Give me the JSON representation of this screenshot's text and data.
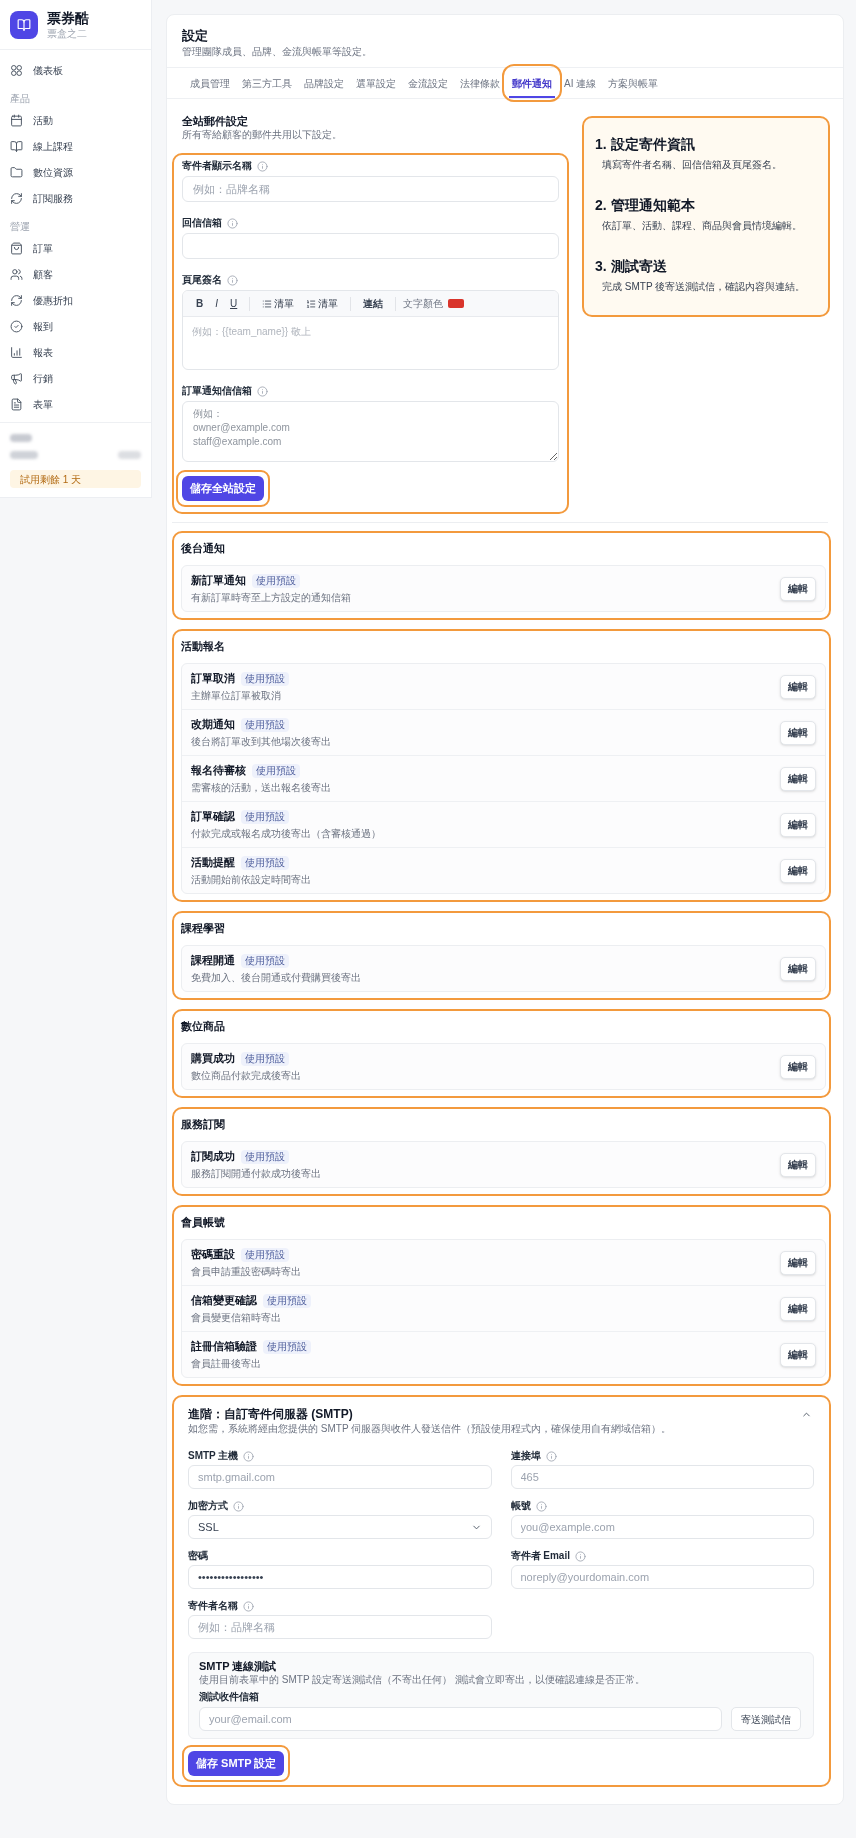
{
  "sidebar": {
    "brand": {
      "name": "票券酷",
      "subtitle": "票盒之二"
    },
    "nav": [
      {
        "items": [
          {
            "label": "儀表板"
          }
        ]
      },
      {
        "heading": "產品",
        "items": [
          {
            "label": "活動"
          },
          {
            "label": "線上課程"
          },
          {
            "label": "數位資源"
          },
          {
            "label": "訂閱服務"
          }
        ]
      },
      {
        "heading": "營運",
        "items": [
          {
            "label": "訂單"
          },
          {
            "label": "顧客"
          },
          {
            "label": "優惠折扣"
          },
          {
            "label": "報到"
          },
          {
            "label": "報表"
          },
          {
            "label": "行銷"
          },
          {
            "label": "表單"
          }
        ]
      }
    ],
    "trial_badge": "試用剩餘 1 天"
  },
  "page": {
    "title": "設定",
    "subtitle": "管理團隊成員、品牌、金流與帳單等設定。"
  },
  "tabs": [
    {
      "label": "成員管理",
      "selected": false,
      "highlighted": false
    },
    {
      "label": "第三方工具",
      "selected": false,
      "highlighted": false
    },
    {
      "label": "品牌設定",
      "selected": false,
      "highlighted": false
    },
    {
      "label": "選單設定",
      "selected": false,
      "highlighted": false
    },
    {
      "label": "金流設定",
      "selected": false,
      "highlighted": false
    },
    {
      "label": "法律條款",
      "selected": false,
      "highlighted": false
    },
    {
      "label": "郵件通知",
      "selected": true,
      "highlighted": true
    },
    {
      "label": "AI 連線",
      "selected": false,
      "highlighted": false
    },
    {
      "label": "方案與帳單",
      "selected": false,
      "highlighted": false
    }
  ],
  "global_settings": {
    "title": "全站郵件設定",
    "subtitle": "所有寄給顧客的郵件共用以下設定。",
    "highlighted": true,
    "fields": [
      {
        "kind": "input",
        "label": "寄件者顯示名稱",
        "info": true,
        "placeholder": "例如：品牌名稱"
      },
      {
        "kind": "input",
        "label": "回信信箱",
        "info": true
      },
      {
        "kind": "editor",
        "label": "頁尾簽名",
        "info": true,
        "toolbar": [
          {
            "kind": "bold",
            "label": "B"
          },
          {
            "kind": "italic",
            "label": "I"
          },
          {
            "kind": "underline",
            "label": "U"
          },
          {
            "kind": "bullet_list",
            "label": "清單"
          },
          {
            "kind": "numbered_list",
            "label": "清單"
          },
          {
            "kind": "link",
            "label": "連結"
          },
          {
            "kind": "color",
            "label": "文字顏色",
            "color": "#d9342b"
          }
        ],
        "placeholder": "例如：{{team_name}} 敬上"
      },
      {
        "kind": "textarea",
        "label": "訂單通知信信箱",
        "info": true,
        "placeholder": "例如：\nowner@example.com\nstaff@example.com"
      }
    ],
    "save_button": {
      "label": "儲存全站設定",
      "highlighted": true
    }
  },
  "guide": {
    "highlighted": true,
    "steps": [
      {
        "title": "1. 設定寄件資訊",
        "text": "填寫寄件者名稱、回信信箱及頁尾簽名。"
      },
      {
        "title": "2. 管理通知範本",
        "text": "依訂單、活動、課程、商品與會員情境編輯。"
      },
      {
        "title": "3. 測試寄送",
        "text": "完成 SMTP 後寄送測試信，確認內容與連結。"
      }
    ]
  },
  "template_sections": [
    {
      "title": "後台通知",
      "highlighted": true,
      "templates": [
        {
          "name": "新訂單通知",
          "badge": "使用預設",
          "description": "有新訂單時寄至上方設定的通知信箱",
          "action": "編輯"
        }
      ]
    },
    {
      "title": "活動報名",
      "highlighted": true,
      "templates": [
        {
          "name": "訂單取消",
          "badge": "使用預設",
          "description": "主辦單位訂單被取消",
          "action": "編輯"
        },
        {
          "name": "改期通知",
          "badge": "使用預設",
          "description": "後台將訂單改到其他場次後寄出",
          "action": "編輯"
        },
        {
          "name": "報名待審核",
          "badge": "使用預設",
          "description": "需審核的活動，送出報名後寄出",
          "action": "編輯"
        },
        {
          "name": "訂單確認",
          "badge": "使用預設",
          "description": "付款完成或報名成功後寄出（含審核通過）",
          "action": "編輯"
        },
        {
          "name": "活動提醒",
          "badge": "使用預設",
          "description": "活動開始前依設定時間寄出",
          "action": "編輯"
        }
      ]
    },
    {
      "title": "課程學習",
      "highlighted": true,
      "templates": [
        {
          "name": "課程開通",
          "badge": "使用預設",
          "description": "免費加入、後台開通或付費購買後寄出",
          "action": "編輯"
        }
      ]
    },
    {
      "title": "數位商品",
      "highlighted": true,
      "templates": [
        {
          "name": "購買成功",
          "badge": "使用預設",
          "description": "數位商品付款完成後寄出",
          "action": "編輯"
        }
      ]
    },
    {
      "title": "服務訂閱",
      "highlighted": true,
      "templates": [
        {
          "name": "訂閱成功",
          "badge": "使用預設",
          "description": "服務訂閱開通付款成功後寄出",
          "action": "編輯"
        }
      ]
    },
    {
      "title": "會員帳號",
      "highlighted": true,
      "templates": [
        {
          "name": "密碼重設",
          "badge": "使用預設",
          "description": "會員申請重設密碼時寄出",
          "action": "編輯"
        },
        {
          "name": "信箱變更確認",
          "badge": "使用預設",
          "description": "會員變更信箱時寄出",
          "action": "編輯"
        },
        {
          "name": "註冊信箱驗證",
          "badge": "使用預設",
          "description": "會員註冊後寄出",
          "action": "編輯"
        }
      ]
    }
  ],
  "smtp": {
    "title": "進階：自訂寄件伺服器 (SMTP)",
    "description": "如您需，系統將經由您提供的 SMTP 伺服器與收件人發送信件（預設使用程式內，確保使用自有網域信箱）。",
    "expanded": true,
    "highlighted": true,
    "fields": [
      {
        "kind": "input",
        "label": "SMTP 主機",
        "info": true,
        "placeholder": "smtp.gmail.com"
      },
      {
        "kind": "input",
        "label": "連接埠",
        "info": true,
        "placeholder": "465"
      },
      {
        "kind": "select",
        "label": "加密方式",
        "info": true,
        "value": "SSL"
      },
      {
        "kind": "input",
        "label": "帳號",
        "info": true,
        "placeholder": "you@example.com"
      },
      {
        "kind": "input",
        "label": "密碼",
        "info": false,
        "value": "•••••••••••••••••"
      },
      {
        "kind": "input",
        "label": "寄件者 Email",
        "info": true,
        "placeholder": "noreply@yourdomain.com"
      },
      {
        "kind": "input",
        "label": "寄件者名稱",
        "info": true,
        "placeholder": "例如：品牌名稱"
      }
    ],
    "test": {
      "title": "SMTP 連線測試",
      "description": "使用目前表單中的 SMTP 設定寄送測試信（不寄出任何） 測試會立即寄出，以便確認連線是否正常。",
      "label": "測試收件信箱",
      "placeholder": "your@email.com",
      "button": "寄送測試信"
    },
    "save_button": {
      "label": "儲存 SMTP 設定",
      "highlighted": true
    }
  }
}
